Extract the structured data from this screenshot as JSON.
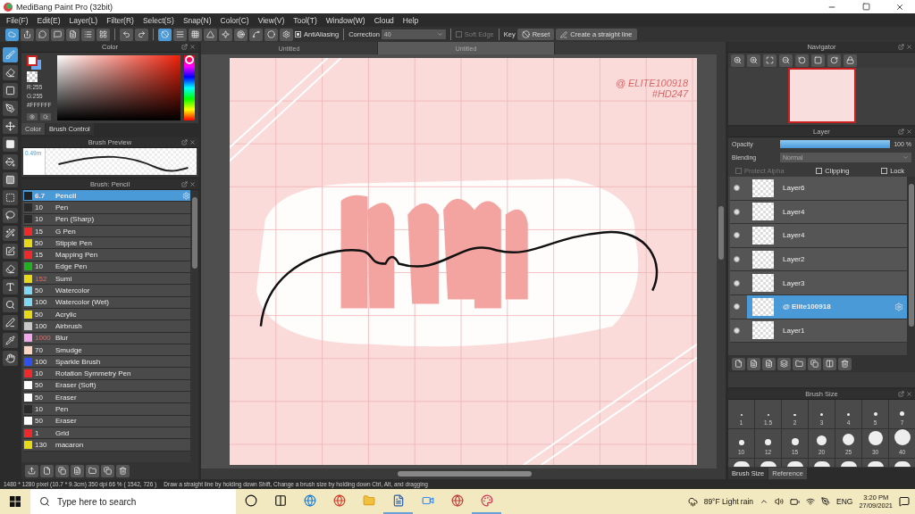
{
  "window": {
    "title": "MediBang Paint Pro (32bit)"
  },
  "menu": [
    "File(F)",
    "Edit(E)",
    "Layer(L)",
    "Filter(R)",
    "Select(S)",
    "Snap(N)",
    "Color(C)",
    "View(V)",
    "Tool(T)",
    "Window(W)",
    "Cloud",
    "Help"
  ],
  "toolbar": {
    "antialiasing": {
      "label": "AntiAliasing",
      "checked": true
    },
    "correction_label": "Correction",
    "correction_value": "40",
    "soft_edge": {
      "label": "Soft Edge",
      "checked": false
    },
    "key_label": "Key",
    "reset": "Reset",
    "straight_line": "Create a straight line"
  },
  "color_panel": {
    "title": "Color",
    "hue": {
      "level": 1
    },
    "r": "R:255",
    "g": "G:255",
    "hex": "#FFFFFF",
    "tabs": [
      {
        "label": "Color",
        "selected": true
      },
      {
        "label": "Brush Control",
        "selected": false
      }
    ]
  },
  "brush_preview": {
    "title": "Brush Preview",
    "size": "0.49m"
  },
  "brush_panel": {
    "title": "Brush: Pencil",
    "brushes": [
      {
        "size": "6.7",
        "name": "Pencil",
        "color": "#222222",
        "selected": true,
        "size_highlighted": true
      },
      {
        "size": "10",
        "name": "Pen",
        "color": "#2a2a2a",
        "selected": false,
        "size_highlighted": false
      },
      {
        "size": "10",
        "name": "Pen (Sharp)",
        "color": "#2a2a2a",
        "selected": false,
        "size_highlighted": false
      },
      {
        "size": "15",
        "name": "G Pen",
        "color": "#ee2a2a",
        "selected": false,
        "size_highlighted": false
      },
      {
        "size": "50",
        "name": "Stipple Pen",
        "color": "#e8d81a",
        "selected": false,
        "size_highlighted": false
      },
      {
        "size": "15",
        "name": "Mapping Pen",
        "color": "#ee2a2a",
        "selected": false,
        "size_highlighted": false
      },
      {
        "size": "10",
        "name": "Edge Pen",
        "color": "#22b022",
        "selected": false,
        "size_highlighted": false
      },
      {
        "size": "152",
        "name": "Sumi",
        "color": "#e8d81a",
        "selected": false,
        "size_highlighted": true
      },
      {
        "size": "50",
        "name": "Watercolor",
        "color": "#7fd8f0",
        "selected": false,
        "size_highlighted": false
      },
      {
        "size": "100",
        "name": "Watercolor (Wet)",
        "color": "#7fd8f0",
        "selected": false,
        "size_highlighted": false
      },
      {
        "size": "50",
        "name": "Acrylic",
        "color": "#e8d81a",
        "selected": false,
        "size_highlighted": false
      },
      {
        "size": "100",
        "name": "Airbrush",
        "color": "#c8c8c8",
        "selected": false,
        "size_highlighted": false
      },
      {
        "size": "1000",
        "name": "Blur",
        "color": "#f4a8ec",
        "selected": false,
        "size_highlighted": true
      },
      {
        "size": "70",
        "name": "Smudge",
        "color": "#fcd8c4",
        "selected": false,
        "size_highlighted": false
      },
      {
        "size": "100",
        "name": "Sparkle Brush",
        "color": "#3050f0",
        "selected": false,
        "size_highlighted": false
      },
      {
        "size": "10",
        "name": "Rotation Symmetry Pen",
        "color": "#ee2a2a",
        "selected": false,
        "size_highlighted": false
      },
      {
        "size": "50",
        "name": "Eraser (Soft)",
        "color": "#ffffff",
        "selected": false,
        "size_highlighted": false
      },
      {
        "size": "50",
        "name": "Eraser",
        "color": "#ffffff",
        "selected": false,
        "size_highlighted": false
      },
      {
        "size": "10",
        "name": "Pen",
        "color": "#2a2a2a",
        "selected": false,
        "size_highlighted": false
      },
      {
        "size": "50",
        "name": "Eraser",
        "color": "#ffffff",
        "selected": false,
        "size_highlighted": false
      },
      {
        "size": "1",
        "name": "Grid",
        "color": "#ee2a2a",
        "selected": false,
        "size_highlighted": false
      },
      {
        "size": "130",
        "name": "macaron",
        "color": "#e8d81a",
        "selected": false,
        "size_highlighted": false
      }
    ]
  },
  "canvas_tabs": [
    {
      "label": "Untitled",
      "selected": false
    },
    {
      "label": "Untitled",
      "selected": true
    }
  ],
  "artwork": {
    "signature": "@ ELITE100918",
    "tag": "#HD247"
  },
  "navigator": {
    "title": "Navigator"
  },
  "layer_panel": {
    "title": "Layer",
    "opacity_label": "Opacity",
    "opacity": {
      "level": 1
    },
    "opacity_reading": "100 %",
    "blending_label": "Blending",
    "blending_value": "Normal",
    "options": [
      {
        "label": "Protect Alpha",
        "checked": false,
        "disabled": true
      },
      {
        "label": "Clipping",
        "checked": false,
        "disabled": false
      },
      {
        "label": "Lock",
        "checked": false,
        "disabled": false
      }
    ],
    "layers": [
      {
        "name": "Layer6",
        "visible": true,
        "selected": false
      },
      {
        "name": "Layer4",
        "visible": true,
        "selected": false
      },
      {
        "name": "Layer4",
        "visible": true,
        "selected": false
      },
      {
        "name": "Layer2",
        "visible": true,
        "selected": false
      },
      {
        "name": "Layer3",
        "visible": true,
        "selected": false
      },
      {
        "name": "@ Elite100918",
        "visible": true,
        "selected": true
      },
      {
        "name": "Layer1",
        "visible": true,
        "selected": false
      }
    ]
  },
  "brush_size": {
    "title": "Brush Size",
    "sizes": [
      "1",
      "1.5",
      "2",
      "3",
      "4",
      "5",
      "7",
      "10",
      "12",
      "15",
      "20",
      "25",
      "30",
      "40"
    ],
    "tabs": [
      {
        "label": "Brush Size",
        "selected": true
      },
      {
        "label": "Reference",
        "selected": false
      }
    ]
  },
  "status_bar": {
    "info": "1480 * 1280 pixel  (10.7 * 9.3cm)  350 dpi  66 %  ( 1542, 726 )",
    "hint": "Draw a straight line by holding down Shift, Change a brush size by holding down Ctrl, Alt, and dragging"
  },
  "taskbar": {
    "search_placeholder": "Type here to search",
    "weather": "89°F  Light rain",
    "language": "ENG",
    "time": "3:20 PM",
    "date": "27/09/2021"
  }
}
